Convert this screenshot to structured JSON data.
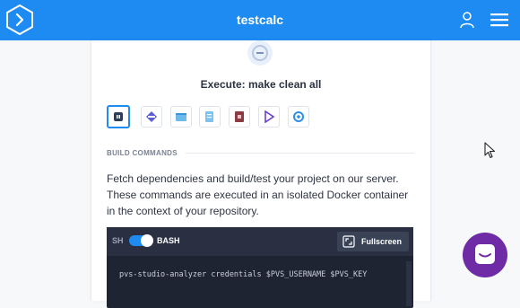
{
  "header": {
    "title": "testcalc",
    "logo_icon": "codacy-chevron-logo",
    "user_icon": "user-icon",
    "menu_icon": "hamburger-menu-icon"
  },
  "card": {
    "status_icon": "gear-status-icon",
    "exec_title": "Execute: make clean all",
    "tools": [
      {
        "icon": "build-icon",
        "active": true
      },
      {
        "icon": "layers-icon",
        "active": false
      },
      {
        "icon": "container-icon",
        "active": false
      },
      {
        "icon": "files-icon",
        "active": false
      },
      {
        "icon": "package-icon",
        "active": false
      },
      {
        "icon": "play-icon",
        "active": false
      },
      {
        "icon": "refresh-icon",
        "active": false
      }
    ],
    "section_label": "BUILD COMMANDS",
    "description": "Fetch dependencies and build/test your project on our server. These commands are executed in an isolated Docker container in the context of your repository.",
    "terminal": {
      "sh_label": "SH",
      "bash_label": "BASH",
      "bash_enabled": true,
      "fullscreen_label": "Fullscreen",
      "code_line": "pvs-studio-analyzer credentials $PVS_USERNAME $PVS_KEY"
    }
  },
  "colors": {
    "topbar": "#1e8bf2",
    "accent": "#1e8bf2",
    "terminal_bg": "#1f2433",
    "chat_bubble": "#6f2aa6"
  }
}
